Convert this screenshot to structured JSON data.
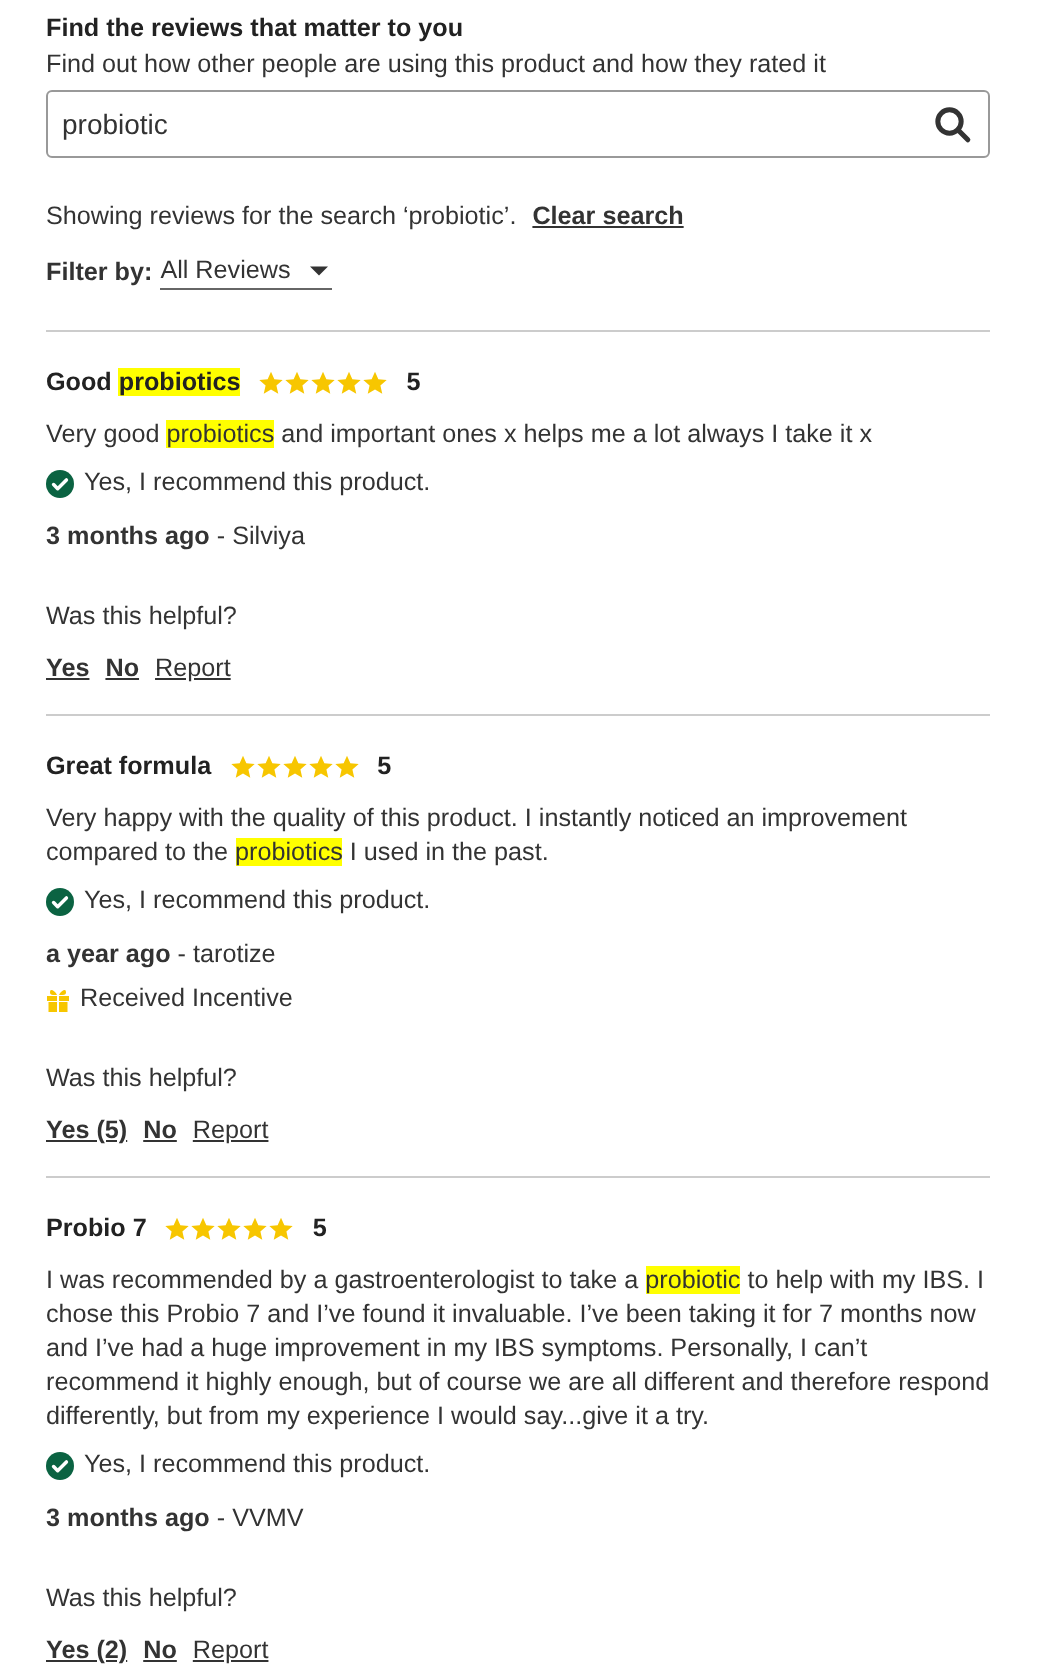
{
  "search_section": {
    "title": "Find the reviews that matter to you",
    "subtitle": "Find out how other people are using this product and how they rated it",
    "search": {
      "value": "probiotic"
    },
    "status": "Showing reviews for the search ‘probiotic’.",
    "clear_link": "Clear search",
    "filter_label": "Filter by:",
    "filter_value": "All Reviews"
  },
  "reviews": [
    {
      "title": [
        {
          "text": "Good ",
          "highlighted": false
        },
        {
          "text": "probiotics",
          "highlighted": true
        }
      ],
      "stars": 5,
      "rating": "5",
      "body": [
        {
          "text": "Very good ",
          "highlighted": false
        },
        {
          "text": "probiotics",
          "highlighted": true
        },
        {
          "text": " and important ones x helps me a lot always I take it x",
          "highlighted": false
        }
      ],
      "recommend": "Yes, I recommend this product.",
      "time": "3 months ago",
      "author": " - Silviya",
      "helpful_prompt": "Was this helpful?",
      "actions": [
        {
          "label": "Yes",
          "kind": "vote"
        },
        {
          "label": "No",
          "kind": "vote"
        },
        {
          "label": "Report",
          "kind": "report"
        }
      ]
    },
    {
      "title": [
        {
          "text": "Great formula",
          "highlighted": false
        }
      ],
      "stars": 5,
      "rating": "5",
      "body": [
        {
          "text": "Very happy with the quality of this product. I instantly noticed an improvement compared to the ",
          "highlighted": false
        },
        {
          "text": "probiotics",
          "highlighted": true
        },
        {
          "text": " I used in the past.",
          "highlighted": false
        }
      ],
      "recommend": "Yes, I recommend this product.",
      "time": "a year ago",
      "author": " - tarotize",
      "incentive": "Received Incentive",
      "helpful_prompt": "Was this helpful?",
      "actions": [
        {
          "label": "Yes (5)",
          "kind": "vote"
        },
        {
          "label": "No",
          "kind": "vote"
        },
        {
          "label": "Report",
          "kind": "report"
        }
      ]
    },
    {
      "title": [
        {
          "text": "Probio 7",
          "highlighted": false
        }
      ],
      "stars": 5,
      "rating": "5",
      "body": [
        {
          "text": "I was recommended by a gastroenterologist to take a ",
          "highlighted": false
        },
        {
          "text": "probiotic",
          "highlighted": true
        },
        {
          "text": " to help with my IBS. I chose this Probio 7 and I’ve found it invaluable. I’ve been taking it for 7 months now and I’ve had a huge improvement in my IBS symptoms. Personally, I can’t recommend it highly enough, but of course we are all different and therefore respond differently, but from my experience I would say...give it a try.",
          "highlighted": false
        }
      ],
      "recommend": "Yes, I recommend this product.",
      "time": "3 months ago",
      "author": " - VVMV",
      "helpful_prompt": "Was this helpful?",
      "actions": [
        {
          "label": "Yes (2)",
          "kind": "vote"
        },
        {
          "label": "No",
          "kind": "vote"
        },
        {
          "label": "Report",
          "kind": "report"
        }
      ]
    }
  ]
}
